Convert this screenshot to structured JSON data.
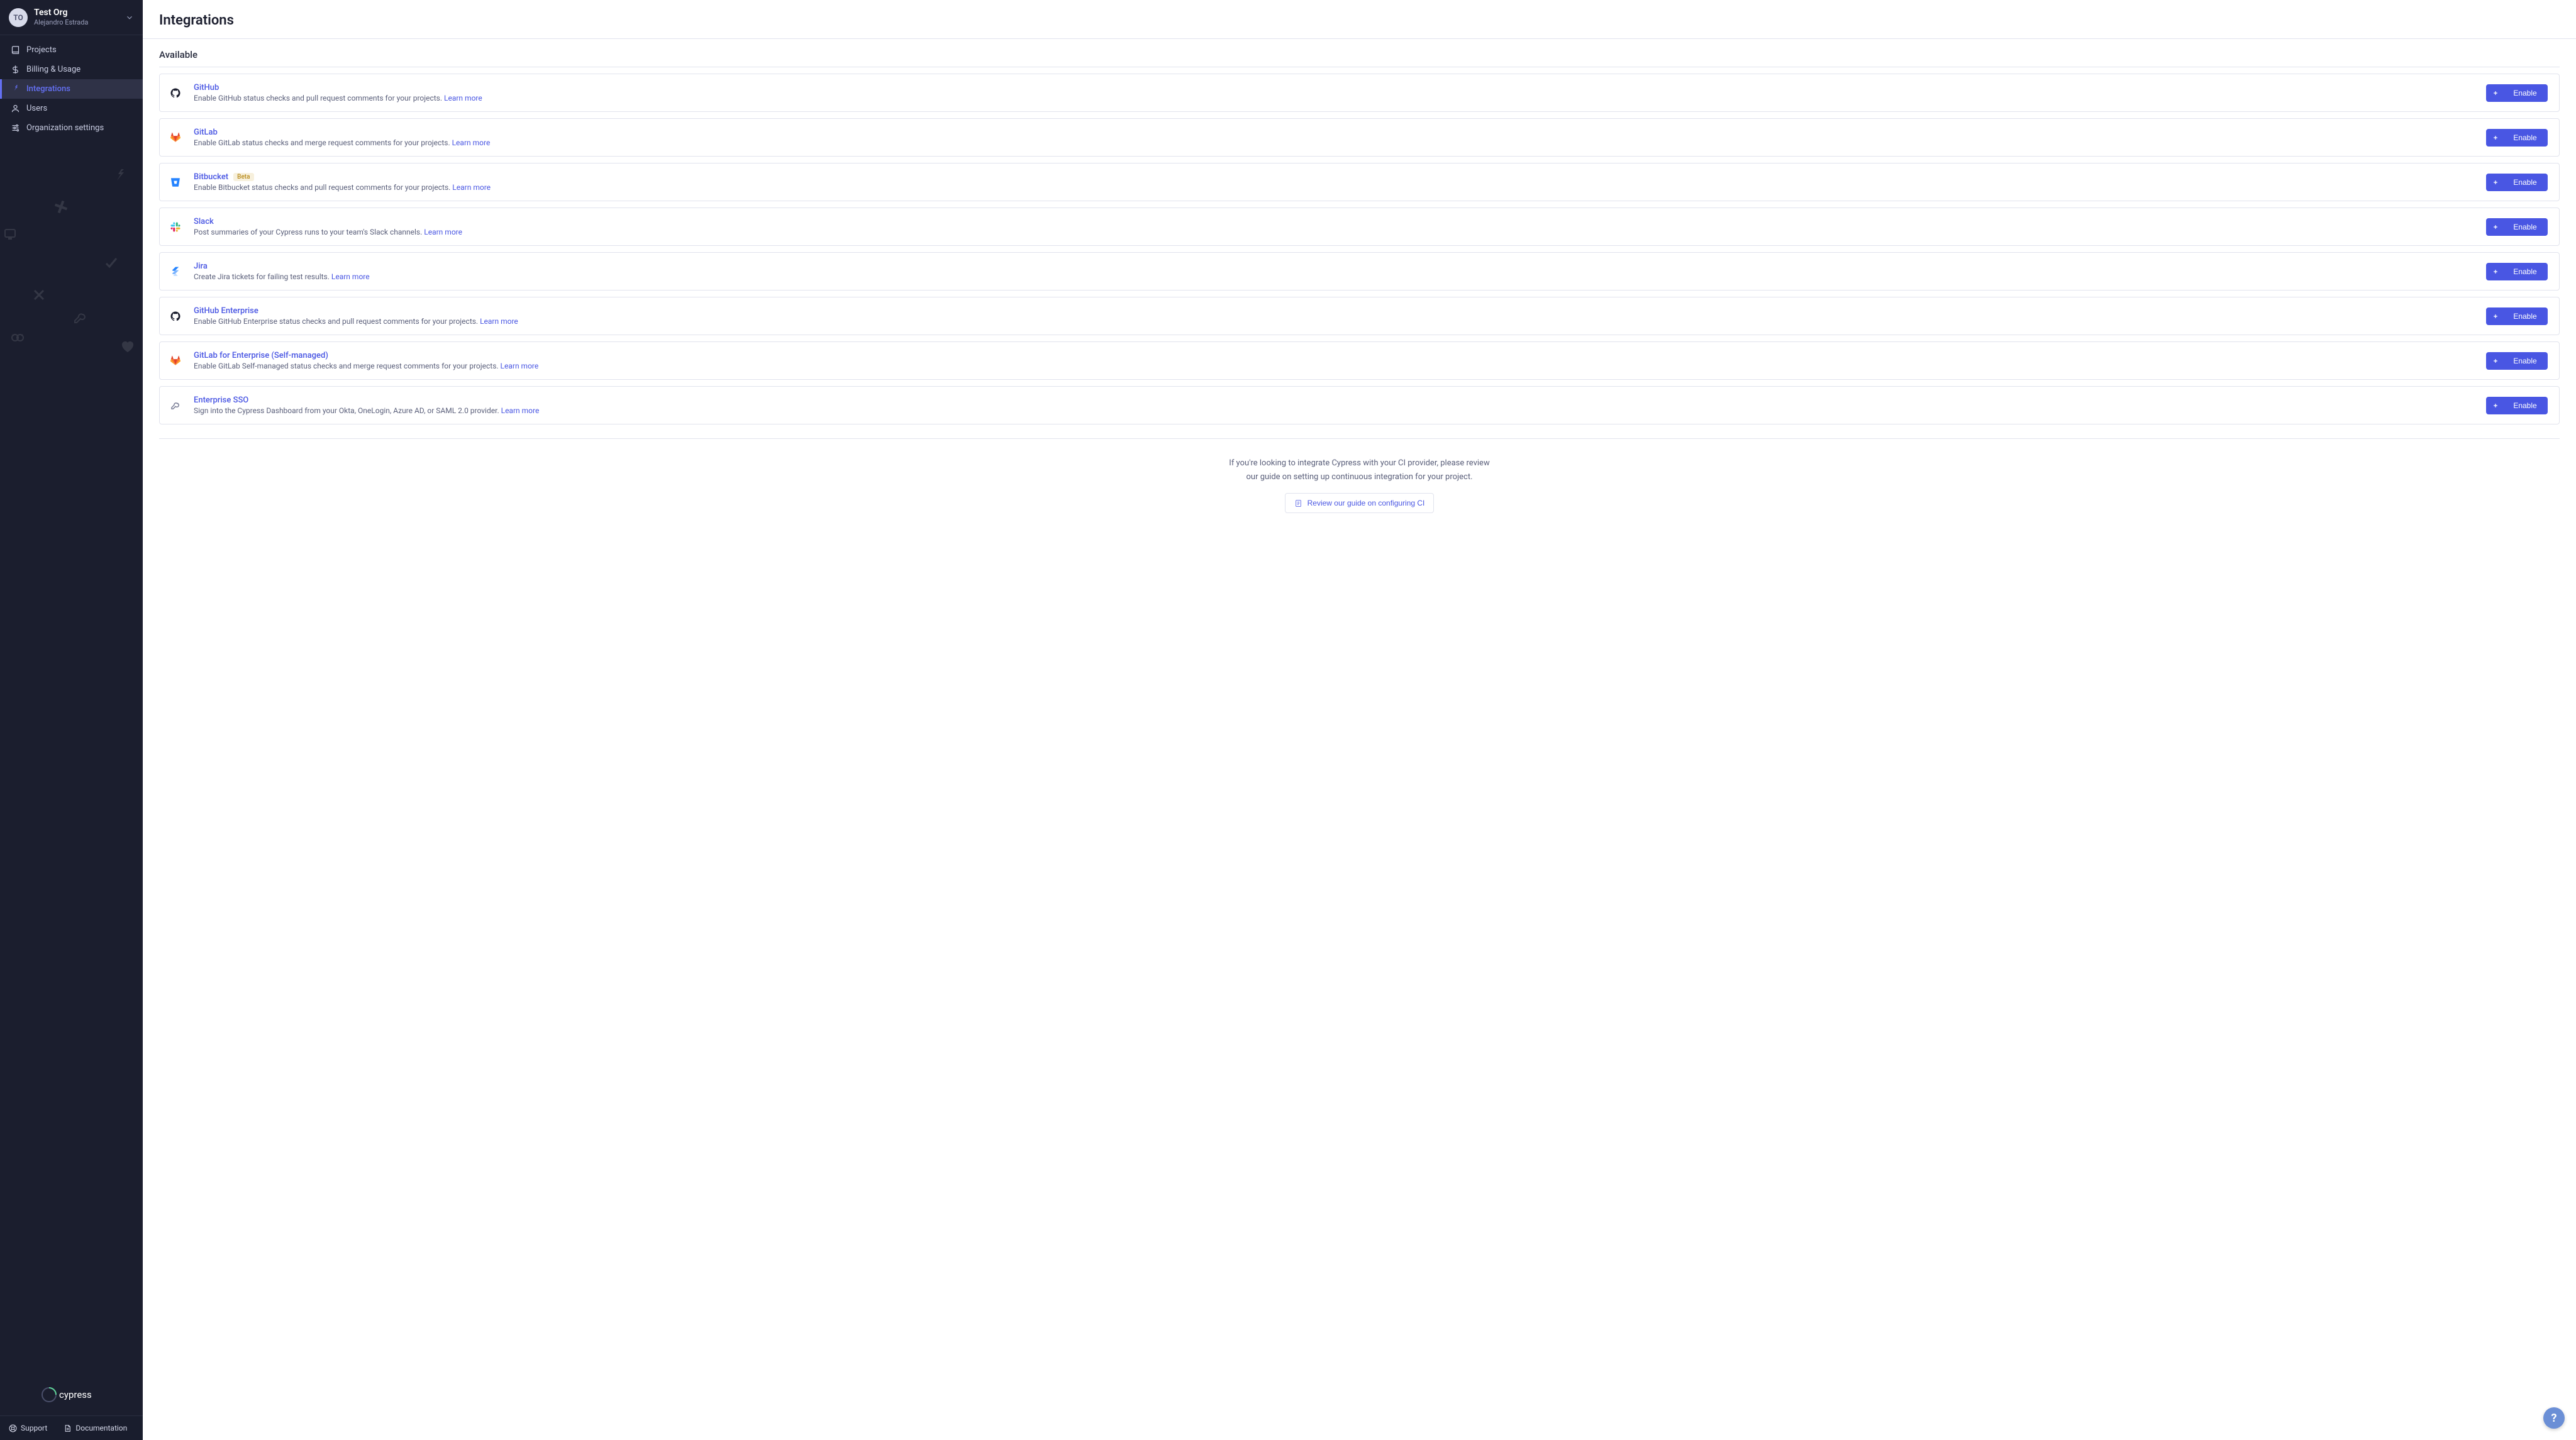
{
  "org": {
    "avatar_initials": "TO",
    "name": "Test Org",
    "user": "Alejandro Estrada"
  },
  "sidebar": {
    "items": [
      {
        "label": "Projects",
        "active": false,
        "icon": "book"
      },
      {
        "label": "Billing & Usage",
        "active": false,
        "icon": "dollar"
      },
      {
        "label": "Integrations",
        "active": true,
        "icon": "plug"
      },
      {
        "label": "Users",
        "active": false,
        "icon": "user"
      },
      {
        "label": "Organization settings",
        "active": false,
        "icon": "sliders"
      }
    ],
    "bottom": {
      "support": "Support",
      "documentation": "Documentation"
    },
    "brand": "cypress"
  },
  "page": {
    "title": "Integrations",
    "section_title": "Available",
    "learn_more": "Learn more",
    "enable": "Enable",
    "integrations": [
      {
        "key": "github",
        "name": "GitHub",
        "badge": null,
        "desc": "Enable GitHub status checks and pull request comments for your projects.",
        "icon": "github",
        "icon_color": "#1b1e2e"
      },
      {
        "key": "gitlab",
        "name": "GitLab",
        "badge": null,
        "desc": "Enable GitLab status checks and merge request comments for your projects.",
        "icon": "gitlab",
        "icon_color": "#e24329"
      },
      {
        "key": "bitbucket",
        "name": "Bitbucket",
        "badge": "Beta",
        "desc": "Enable Bitbucket status checks and pull request comments for your projects.",
        "icon": "bitbucket",
        "icon_color": "#2684ff"
      },
      {
        "key": "slack",
        "name": "Slack",
        "badge": null,
        "desc": "Post summaries of your Cypress runs to your team's Slack channels.",
        "icon": "slack",
        "icon_color": null
      },
      {
        "key": "jira",
        "name": "Jira",
        "badge": null,
        "desc": "Create Jira tickets for failing test results.",
        "icon": "jira",
        "icon_color": "#2684ff"
      },
      {
        "key": "github-enterprise",
        "name": "GitHub Enterprise",
        "badge": null,
        "desc": "Enable GitHub Enterprise status checks and pull request comments for your projects.",
        "icon": "github",
        "icon_color": "#1b1e2e"
      },
      {
        "key": "gitlab-enterprise",
        "name": "GitLab for Enterprise (Self-managed)",
        "badge": null,
        "desc": "Enable GitLab Self-managed status checks and merge request comments for your projects.",
        "icon": "gitlab",
        "icon_color": "#e24329"
      },
      {
        "key": "sso",
        "name": "Enterprise SSO",
        "badge": null,
        "desc": "Sign into the Cypress Dashboard from your Okta, OneLogin, Azure AD, or SAML 2.0 provider.",
        "icon": "key",
        "icon_color": "#7a7e96"
      }
    ],
    "footer": {
      "text": "If you're looking to integrate Cypress with your CI provider, please review our guide on setting up continuous integration for your project.",
      "button": "Review our guide on configuring CI"
    }
  },
  "help_fab": "?"
}
